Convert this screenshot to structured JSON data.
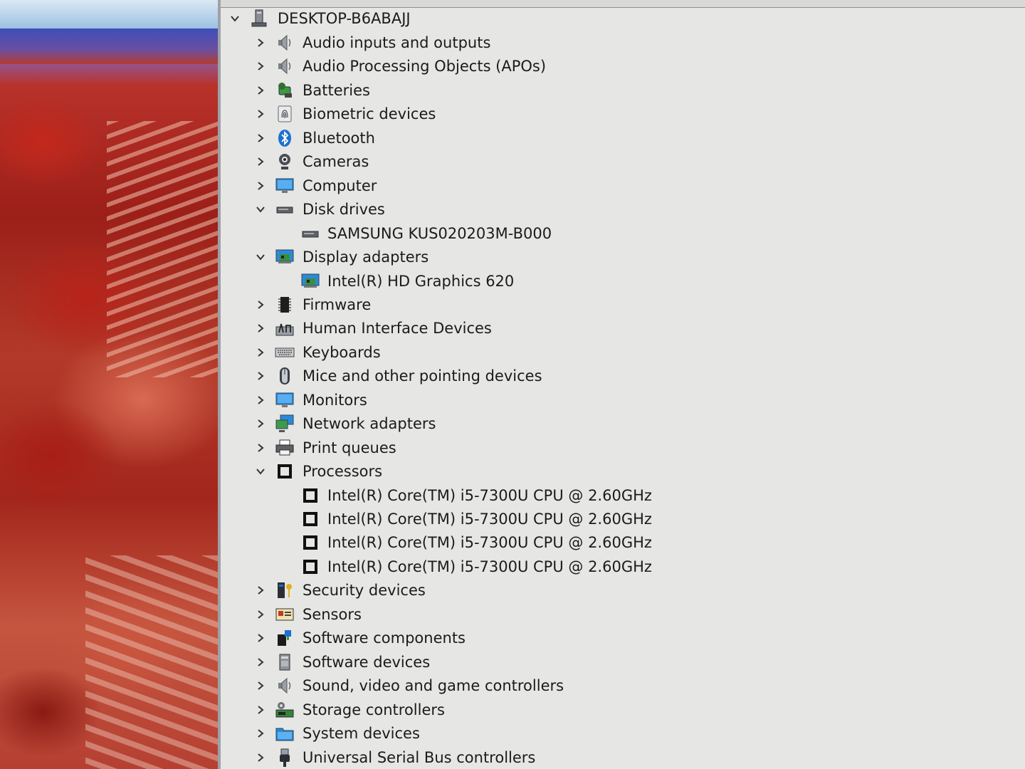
{
  "tree": {
    "root": {
      "label": "DESKTOP-B6ABAJJ",
      "icon": "computer-tower-icon",
      "expanded": true
    },
    "items": [
      {
        "label": "Audio inputs and outputs",
        "icon": "speaker-icon",
        "expanded": false
      },
      {
        "label": "Audio Processing Objects (APOs)",
        "icon": "speaker-icon",
        "expanded": false
      },
      {
        "label": "Batteries",
        "icon": "battery-icon",
        "expanded": false
      },
      {
        "label": "Biometric devices",
        "icon": "fingerprint-icon",
        "expanded": false
      },
      {
        "label": "Bluetooth",
        "icon": "bluetooth-icon",
        "expanded": false
      },
      {
        "label": "Cameras",
        "icon": "webcam-icon",
        "expanded": false
      },
      {
        "label": "Computer",
        "icon": "monitor-icon",
        "expanded": false
      },
      {
        "label": "Disk drives",
        "icon": "disk-drive-icon",
        "expanded": true
      },
      {
        "label": "SAMSUNG KUS020203M-B000",
        "icon": "disk-drive-icon",
        "child": true
      },
      {
        "label": "Display adapters",
        "icon": "display-adapter-icon",
        "expanded": true
      },
      {
        "label": "Intel(R) HD Graphics 620",
        "icon": "display-adapter-icon",
        "child": true
      },
      {
        "label": "Firmware",
        "icon": "chip-icon",
        "expanded": false
      },
      {
        "label": "Human Interface Devices",
        "icon": "hid-icon",
        "expanded": false
      },
      {
        "label": "Keyboards",
        "icon": "keyboard-icon",
        "expanded": false
      },
      {
        "label": "Mice and other pointing devices",
        "icon": "mouse-icon",
        "expanded": false
      },
      {
        "label": "Monitors",
        "icon": "monitor-icon",
        "expanded": false
      },
      {
        "label": "Network adapters",
        "icon": "network-icon",
        "expanded": false
      },
      {
        "label": "Print queues",
        "icon": "printer-icon",
        "expanded": false
      },
      {
        "label": "Processors",
        "icon": "processor-icon",
        "expanded": true
      },
      {
        "label": "Intel(R) Core(TM) i5-7300U CPU @ 2.60GHz",
        "icon": "processor-icon",
        "child": true
      },
      {
        "label": "Intel(R) Core(TM) i5-7300U CPU @ 2.60GHz",
        "icon": "processor-icon",
        "child": true
      },
      {
        "label": "Intel(R) Core(TM) i5-7300U CPU @ 2.60GHz",
        "icon": "processor-icon",
        "child": true
      },
      {
        "label": "Intel(R) Core(TM) i5-7300U CPU @ 2.60GHz",
        "icon": "processor-icon",
        "child": true
      },
      {
        "label": "Security devices",
        "icon": "security-key-icon",
        "expanded": false
      },
      {
        "label": "Sensors",
        "icon": "sensor-icon",
        "expanded": false
      },
      {
        "label": "Software components",
        "icon": "puzzle-icon",
        "expanded": false
      },
      {
        "label": "Software devices",
        "icon": "software-device-icon",
        "expanded": false
      },
      {
        "label": "Sound, video and game controllers",
        "icon": "speaker-icon",
        "expanded": false
      },
      {
        "label": "Storage controllers",
        "icon": "storage-controller-icon",
        "expanded": false
      },
      {
        "label": "System devices",
        "icon": "system-folder-icon",
        "expanded": false
      },
      {
        "label": "Universal Serial Bus controllers",
        "icon": "usb-icon",
        "expanded": false
      }
    ]
  },
  "colors": {
    "panel_bg": "#e6e6e4",
    "text": "#1b1b1b",
    "chevron": "#333333",
    "accent_blue": "#1e6fd0"
  }
}
